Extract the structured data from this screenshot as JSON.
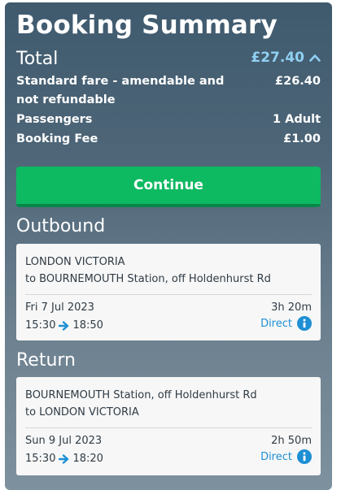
{
  "summary": {
    "title": "Booking Summary",
    "total_label": "Total",
    "total_value": "£27.40",
    "fare_label": "Standard fare - amendable and not refundable",
    "fare_value": "£26.40",
    "passengers_label": "Passengers",
    "passengers_value": "1 Adult",
    "fee_label": "Booking Fee",
    "fee_value": "£1.00",
    "continue_label": "Continue"
  },
  "outbound": {
    "heading": "Outbound",
    "from": "LONDON VICTORIA",
    "to": "to BOURNEMOUTH Station, off Holdenhurst Rd",
    "date": "Fri 7 Jul 2023",
    "duration": "3h 20m",
    "depart": "15:30",
    "arrive": "18:50",
    "type": "Direct"
  },
  "return": {
    "heading": "Return",
    "from": "BOURNEMOUTH Station, off Holdenhurst Rd",
    "to": "to LONDON VICTORIA",
    "date": "Sun 9 Jul 2023",
    "duration": "2h 50m",
    "depart": "15:30",
    "arrive": "18:20",
    "type": "Direct"
  },
  "colors": {
    "accent_green": "#0db961",
    "link_blue": "#1e8fd3",
    "total_blue": "#8fd0f2"
  },
  "icons": {
    "total_toggle": "chevron-up-icon",
    "journey_arrow": "arrow-right-icon",
    "journey_info": "info-icon"
  }
}
